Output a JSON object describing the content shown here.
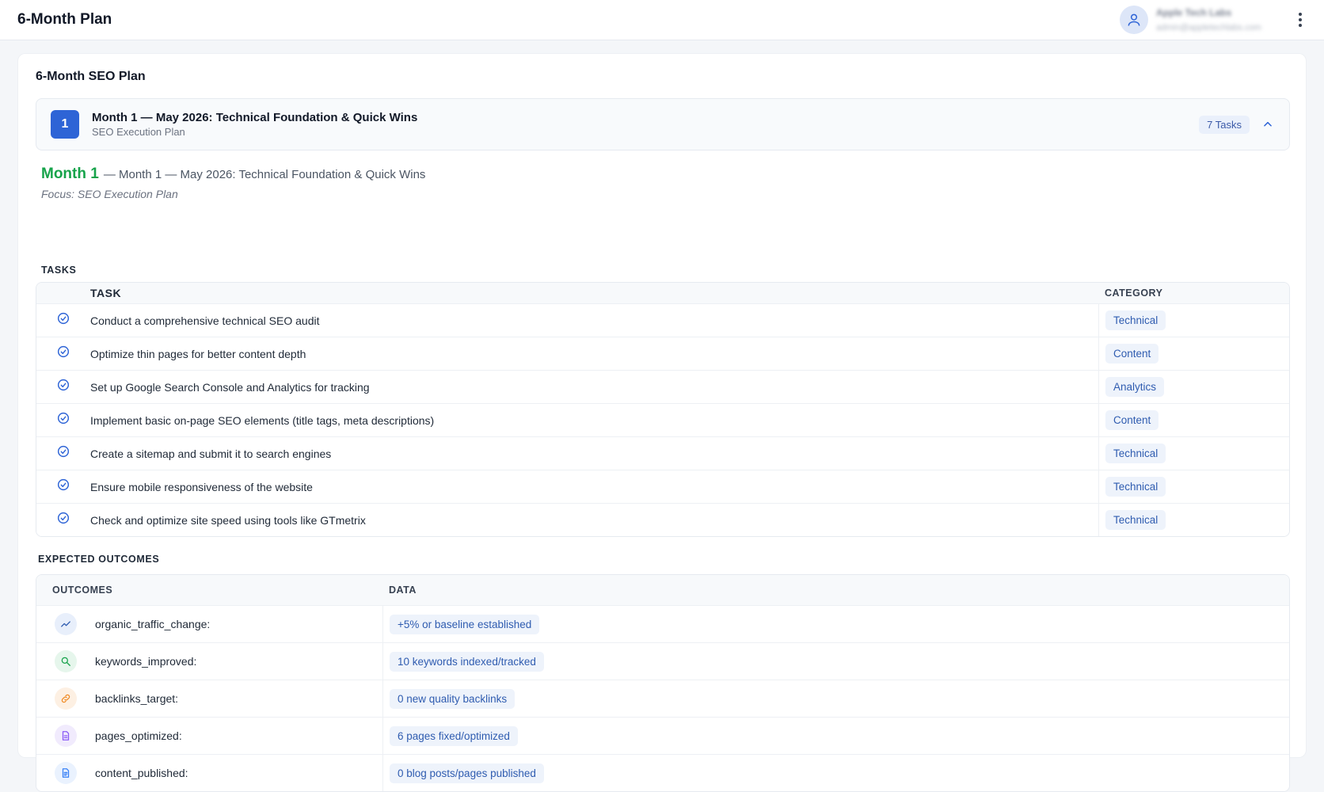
{
  "app": {
    "title": "6-Month Plan"
  },
  "user": {
    "name": "Apple Tech Labs",
    "email": "admin@appletechlabs.com"
  },
  "plan": {
    "title": "6-Month SEO Plan"
  },
  "month": {
    "number": "1",
    "title": "Month 1 — May 2026: Technical Foundation & Quick Wins",
    "subtitle": "SEO Execution Plan",
    "tasks_count": "7 Tasks",
    "label": "Month 1",
    "detail": "— Month 1 — May 2026: Technical Foundation & Quick Wins",
    "focus": "Focus: SEO Execution Plan"
  },
  "tasks_section": {
    "label": "TASKS",
    "col_task": "TASK",
    "col_category": "CATEGORY",
    "rows": [
      {
        "task": "Conduct a comprehensive technical SEO audit",
        "category": "Technical"
      },
      {
        "task": "Optimize thin pages for better content depth",
        "category": "Content"
      },
      {
        "task": "Set up Google Search Console and Analytics for tracking",
        "category": "Analytics"
      },
      {
        "task": "Implement basic on-page SEO elements (title tags, meta descriptions)",
        "category": "Content"
      },
      {
        "task": "Create a sitemap and submit it to search engines",
        "category": "Technical"
      },
      {
        "task": "Ensure mobile responsiveness of the website",
        "category": "Technical"
      },
      {
        "task": "Check and optimize site speed using tools like GTmetrix",
        "category": "Technical"
      }
    ]
  },
  "outcomes_section": {
    "label": "EXPECTED OUTCOMES",
    "col_outcomes": "OUTCOMES",
    "col_data": "DATA",
    "rows": [
      {
        "name": "organic_traffic_change:",
        "value": "+5% or baseline established",
        "icon": "trend-up-icon",
        "color": "#2f5cb0",
        "bg": "#e8effb"
      },
      {
        "name": "keywords_improved:",
        "value": "10 keywords indexed/tracked",
        "icon": "search-icon",
        "color": "#16a34a",
        "bg": "#e6f6ec"
      },
      {
        "name": "backlinks_target:",
        "value": "0 new quality backlinks",
        "icon": "link-icon",
        "color": "#f08a24",
        "bg": "#fdf0e3"
      },
      {
        "name": "pages_optimized:",
        "value": "6 pages fixed/optimized",
        "icon": "document-icon",
        "color": "#8b5cf6",
        "bg": "#f1ebfd"
      },
      {
        "name": "content_published:",
        "value": "0 blog posts/pages published",
        "icon": "file-text-icon",
        "color": "#3b82f6",
        "bg": "#eaf2fe"
      }
    ]
  },
  "colors": {
    "accent": "#2e64d6",
    "month_green": "#16a34a",
    "pill_bg": "#eef3fb",
    "pill_text": "#2f5cb0"
  }
}
